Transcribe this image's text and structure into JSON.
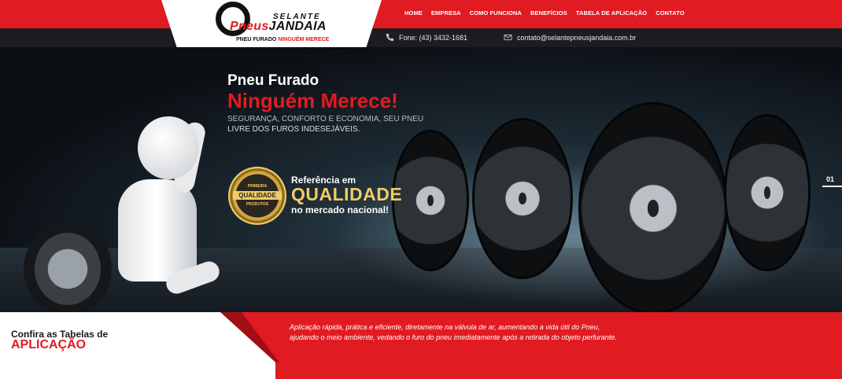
{
  "header": {
    "brand": {
      "top": "SELANTE",
      "pneus": "Pneus",
      "jandaia": "JANDAIA",
      "tagline_black": "PNEU FURADO",
      "tagline_red": "NINGUÉM MERECE"
    },
    "nav": [
      "HOME",
      "EMPRESA",
      "COMO FUNCIONA",
      "BENEFÍCIOS",
      "TABELA DE APLICAÇÃO",
      "CONTATO"
    ],
    "phone": "Fone: (43) 3432-1681",
    "email": "contato@selantepneusjandaia.com.br"
  },
  "hero": {
    "title_line1": "Pneu Furado",
    "title_line2": "Ninguém Merece!",
    "subtitle_line1": "SEGURANÇA, CONFORTO E ECONOMIA, SEU PNEU",
    "subtitle_line2": "LIVRE DOS FUROS INDESEJÁVEIS.",
    "seal": {
      "top": "PRIMEIRA",
      "middle": "QUALIDADE",
      "bottom": "PRODUTOS"
    },
    "reference_line1": "Referência em",
    "reference_line2": "QUALIDADE",
    "reference_line3": "no mercado nacional!",
    "slide_number": "01"
  },
  "bottom": {
    "cta_line1": "Confira as Tabelas de",
    "cta_line2": "APLICAÇÃO",
    "description": "Aplicação rápida, prática e eficiente, diretamente na válvula de ar, aumentando a vida útil do Pneu, ajudando o meio ambiente, vedando o furo do pneu imediatamente após a retirada do objeto perfurante."
  },
  "colors": {
    "accent": "#e11b22",
    "dark": "#1b1d21",
    "gold": "#f0cb66"
  },
  "icons": {
    "phone": "phone-icon",
    "email": "email-icon"
  }
}
